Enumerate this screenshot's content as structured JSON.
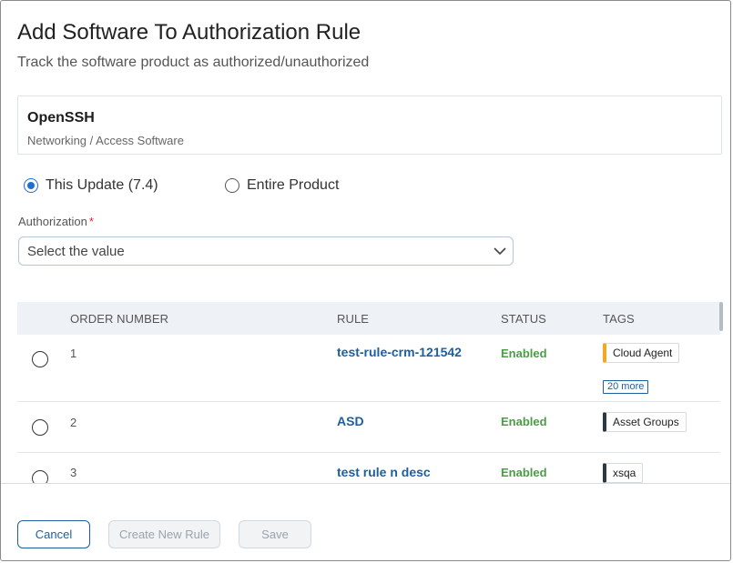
{
  "dialog": {
    "title": "Add Software To Authorization Rule",
    "subtitle": "Track the software product as authorized/unauthorized"
  },
  "product": {
    "name": "OpenSSH",
    "category": "Networking / Access Software"
  },
  "scope": {
    "options": [
      {
        "label": "This Update (7.4)",
        "selected": true
      },
      {
        "label": "Entire Product",
        "selected": false
      }
    ]
  },
  "authorization": {
    "label": "Authorization",
    "required_mark": "*",
    "placeholder": "Select the value"
  },
  "table": {
    "headers": [
      "ORDER NUMBER",
      "RULE",
      "STATUS",
      "TAGS"
    ],
    "rows": [
      {
        "order": "1",
        "rule": "test-rule-crm-121542",
        "status": "Enabled",
        "tag": "Cloud Agent",
        "tag_color": "#f5a623",
        "more": "20 more"
      },
      {
        "order": "2",
        "rule": "ASD",
        "status": "Enabled",
        "tag": "Asset Groups",
        "tag_color": "#2d3a44"
      },
      {
        "order": "3",
        "rule": "test rule n desc",
        "status": "Enabled",
        "tag": "xsqa",
        "tag_color": "#2d3a44"
      }
    ]
  },
  "footer": {
    "cancel": "Cancel",
    "create": "Create New Rule",
    "save": "Save"
  },
  "colors": {
    "accent": "#1f6fd1",
    "link": "#1d5f9e",
    "enabled": "#4a9c46",
    "required": "#d7263d"
  }
}
